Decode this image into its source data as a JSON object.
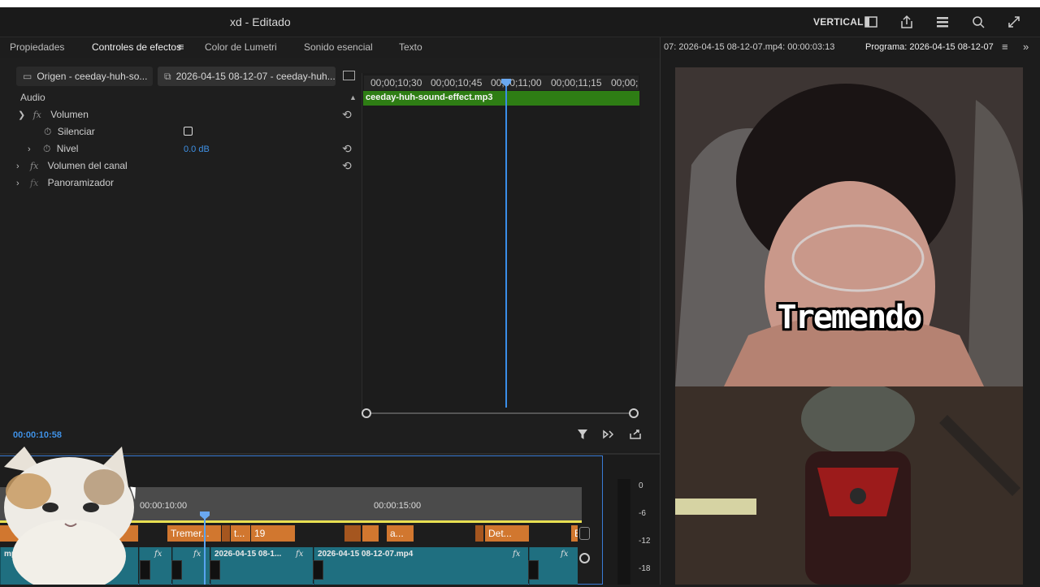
{
  "window": {
    "title": "xd - Editado",
    "workspace_label": "VERTICAL"
  },
  "tabs": [
    {
      "label": "Propiedades"
    },
    {
      "label": "Controles de efectos"
    },
    {
      "label": "Color de Lumetri"
    },
    {
      "label": "Sonido esencial"
    },
    {
      "label": "Texto"
    }
  ],
  "effect_controls": {
    "source_tab": "Origen - ceeday-huh-so...",
    "sequence_tab": "2026-04-15 08-12-07 - ceeday-huh...",
    "section_label": "Audio",
    "rows": {
      "volumen": "Volumen",
      "silenciar": "Silenciar",
      "nivel": "Nivel",
      "nivel_value": "0.0 dB",
      "volumen_canal": "Volumen del canal",
      "panoramizador": "Panoramizador"
    },
    "ruler_labels": [
      "00;00;10;30",
      "00;00;10;45",
      "00;00;11;00",
      "00;00;11;15",
      "00;00;"
    ],
    "clip_name": "ceeday-huh-sound-effect.mp3",
    "timecode": "00:00:10:58"
  },
  "sequence": {
    "tc_labels": [
      "00:00:10:00",
      "00:00:15:00"
    ],
    "orange_clips": [
      "Tremer...",
      "t...",
      "19",
      "a...",
      "Det...",
      "E"
    ],
    "teal_clips": [
      "mp4",
      "2026-04-15 08-1...",
      "2026-04-15 08-12-07.mp4"
    ],
    "fx": "fx",
    "meter_labels": [
      "0",
      "-6",
      "-12",
      "-18"
    ]
  },
  "program": {
    "source_tab": "07: 2026-04-15 08-12-07.mp4: 00:00:03:13",
    "program_tab": "Programa: 2026-04-15 08-12-07",
    "caption": "Tremendo"
  },
  "colors": {
    "accent": "#2d8ceb",
    "audio_clip": "#2e7d14",
    "orange_clip": "#d1772f",
    "teal_clip": "#1f6f80"
  }
}
